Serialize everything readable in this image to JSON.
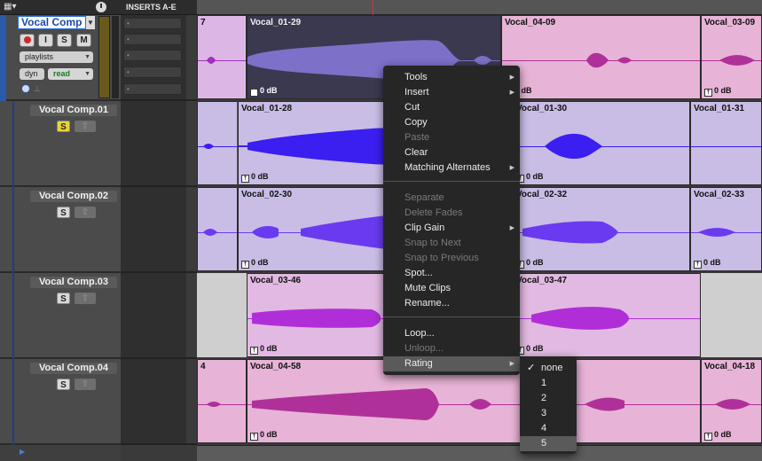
{
  "header": {
    "inserts_label": "INSERTS A-E"
  },
  "track1": {
    "name": "Vocal Comp",
    "input_monitor_label": "I",
    "solo_label": "S",
    "mute_label": "M",
    "playlists_label": "playlists",
    "view_label": "dyn",
    "automation_label": "read",
    "clips": [
      {
        "name": "7",
        "gain": ""
      },
      {
        "name": "Vocal_01-29",
        "gain": "0 dB"
      },
      {
        "name": "Vocal_04-09",
        "gain": "0 dB"
      },
      {
        "name": "Vocal_03-09",
        "gain": "0 dB"
      }
    ]
  },
  "tracks": [
    {
      "name": "Vocal Comp.01",
      "solo": "S",
      "clips": [
        {
          "name": "Vocal_01-28",
          "gain": "0 dB"
        },
        {
          "name": "Vocal_01-30",
          "gain": "0 dB"
        },
        {
          "name": "Vocal_01-31",
          "gain": "0 dB"
        }
      ]
    },
    {
      "name": "Vocal Comp.02",
      "solo": "S",
      "clips": [
        {
          "name": "Vocal_02-30",
          "gain": "0 dB"
        },
        {
          "name": "Vocal_02-32",
          "gain": "0 dB"
        },
        {
          "name": "Vocal_02-33",
          "gain": "0 dB"
        }
      ]
    },
    {
      "name": "Vocal Comp.03",
      "solo": "S",
      "clips": [
        {
          "name": "Vocal_03-46",
          "gain": "0 dB"
        },
        {
          "name": "Vocal_03-47",
          "gain": "0 dB"
        }
      ]
    },
    {
      "name": "Vocal Comp.04",
      "solo": "S",
      "clips": [
        {
          "name": "4",
          "gain": ""
        },
        {
          "name": "Vocal_04-58",
          "gain": "0 dB"
        },
        {
          "name": "Vocal_04-18",
          "gain": "0 dB"
        }
      ]
    }
  ],
  "context_menu": {
    "items": [
      {
        "label": "Tools",
        "disabled": false,
        "submenu": true
      },
      {
        "label": "Insert",
        "disabled": false,
        "submenu": true
      },
      {
        "label": "Cut",
        "disabled": false
      },
      {
        "label": "Copy",
        "disabled": false
      },
      {
        "label": "Paste",
        "disabled": true
      },
      {
        "label": "Clear",
        "disabled": false
      },
      {
        "label": "Matching Alternates",
        "disabled": false,
        "submenu": true
      },
      {
        "label": "Separate",
        "disabled": true
      },
      {
        "label": "Delete Fades",
        "disabled": true
      },
      {
        "label": "Clip Gain",
        "disabled": false,
        "submenu": true
      },
      {
        "label": "Snap to Next",
        "disabled": true
      },
      {
        "label": "Snap to Previous",
        "disabled": true
      },
      {
        "label": "Spot...",
        "disabled": false
      },
      {
        "label": "Mute Clips",
        "disabled": false
      },
      {
        "label": "Rename...",
        "disabled": false
      },
      {
        "label": "Loop...",
        "disabled": false
      },
      {
        "label": "Unloop...",
        "disabled": true
      },
      {
        "label": "Rating",
        "disabled": false,
        "submenu": true,
        "highlighted": true
      }
    ]
  },
  "rating_submenu": {
    "items": [
      "none",
      "1",
      "2",
      "3",
      "4",
      "5"
    ],
    "checked": "none",
    "hovered": "5"
  },
  "colors": {
    "clip_lavender": "#c9bde6",
    "clip_pink": "#e6b8d9",
    "wave_blue": "#5a3ef0",
    "wave_magenta": "#b03ab8",
    "wave_violet": "#9a6ef0"
  }
}
